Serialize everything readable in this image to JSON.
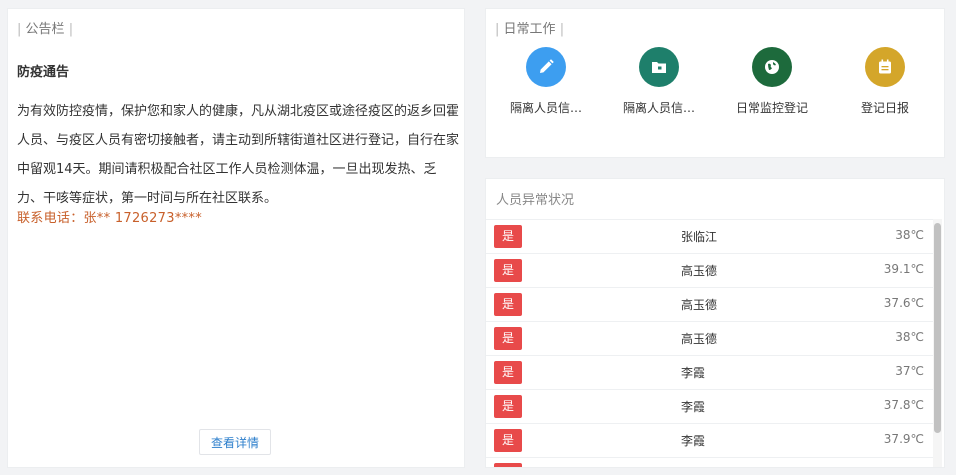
{
  "notice": {
    "bar_left": "|",
    "title": "公告栏",
    "bar_right": "|",
    "heading": "防疫通告",
    "body": "为有效防控疫情，保护您和家人的健康，凡从湖北疫区或途径疫区的返乡回霍人员、与疫区人员有密切接触者，请主动到所辖街道社区进行登记，自行在家中留观14天。期间请积极配合社区工作人员检测体温，一旦出现发热、乏力、干咳等症状，第一时间与所在社区联系。",
    "contact": "联系电话：张**  1726273****",
    "detail_button": "查看详情"
  },
  "work": {
    "bar_left": "|",
    "title": "日常工作",
    "bar_right": "|",
    "items": [
      {
        "label": "隔离人员信…",
        "icon": "pencil-icon",
        "color": "#3d9ef0"
      },
      {
        "label": "隔离人员信…",
        "icon": "folder-icon",
        "color": "#1e7f6b"
      },
      {
        "label": "日常监控登记",
        "icon": "globe-icon",
        "color": "#1d6a3c"
      },
      {
        "label": "登记日报",
        "icon": "calendar-icon",
        "color": "#d4a62a"
      }
    ]
  },
  "abnormal": {
    "title": "人员异常状况",
    "rows": [
      {
        "badge": "是",
        "name": "张临江",
        "temp": "38℃"
      },
      {
        "badge": "是",
        "name": "高玉德",
        "temp": "39.1℃"
      },
      {
        "badge": "是",
        "name": "高玉德",
        "temp": "37.6℃"
      },
      {
        "badge": "是",
        "name": "高玉德",
        "temp": "38℃"
      },
      {
        "badge": "是",
        "name": "李霞",
        "temp": "37℃"
      },
      {
        "badge": "是",
        "name": "李霞",
        "temp": "37.8℃"
      },
      {
        "badge": "是",
        "name": "李霞",
        "temp": "37.9℃"
      },
      {
        "badge": "是",
        "name": "",
        "temp": ""
      }
    ]
  }
}
